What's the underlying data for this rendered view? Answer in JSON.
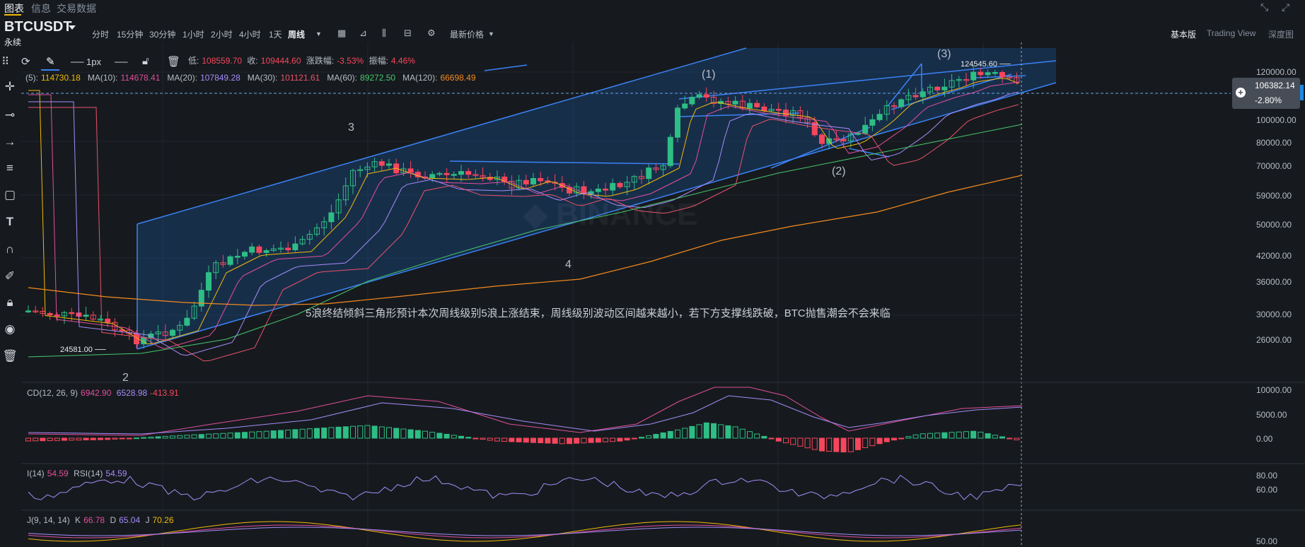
{
  "top_tabs": {
    "chart": "图表",
    "info": "信息",
    "trading_data": "交易数据"
  },
  "symbol": {
    "name": "BTCUSDT",
    "type": "永续"
  },
  "intervals": [
    "分时",
    "15分钟",
    "30分钟",
    "1小时",
    "2小时",
    "4小时",
    "1天",
    "周线"
  ],
  "price_type": "最新价格",
  "views": {
    "basic": "基本版",
    "tradingview": "Trading View",
    "depth": "深度图"
  },
  "drawbar": {
    "width_label": "1px"
  },
  "ohlc": {
    "low_label": "低:",
    "low": "108559.70",
    "close_label": "收:",
    "close": "109444.60",
    "change_label": "涨跌幅:",
    "change": "-3.53%",
    "amp_label": "振幅:",
    "amp": "4.46%"
  },
  "ma": [
    {
      "label": "(5):",
      "value": "114730.18",
      "color": "#f0b90b"
    },
    {
      "label": "MA(10):",
      "value": "114678.41",
      "color": "#e04f9c"
    },
    {
      "label": "MA(20):",
      "value": "107849.28",
      "color": "#a78bfa"
    },
    {
      "label": "MA(30):",
      "value": "101121.61",
      "color": "#e8526b"
    },
    {
      "label": "MA(60):",
      "value": "89272.50",
      "color": "#48c76f"
    },
    {
      "label": "MA(120):",
      "value": "66698.49",
      "color": "#f58a1f"
    }
  ],
  "price_axis": [
    "120000.00",
    "100000.00",
    "80000.00",
    "70000.00",
    "59000.00",
    "50000.00",
    "42000.00",
    "36000.00",
    "30000.00",
    "26000.00"
  ],
  "price_tag": {
    "price": "106382.14",
    "change": "-2.80%"
  },
  "annotations": {
    "wave1": "(1)",
    "wave2": "(2)",
    "wave3": "(3)",
    "num3": "3",
    "num4": "4",
    "num2": "2",
    "high": "124545.60",
    "low": "24581.00",
    "note": "5浪终结倾斜三角形预计本次周线级别5浪上涨结束，周线级别波动区间越来越小，若下方支撑线跌破，BTC抛售潮会不会来临"
  },
  "macd": {
    "label": "CD(12, 26, 9)",
    "dif": "6942.90",
    "dea": "6528.98",
    "hist": "-413.91",
    "axis": [
      "10000.00",
      "5000.00",
      "0.00"
    ]
  },
  "rsi": {
    "label1": "I(14)",
    "v1": "54.59",
    "label2": "RSI(14)",
    "v2": "54.59",
    "axis": [
      "80.00",
      "60.00"
    ]
  },
  "kdj": {
    "label": "J(9, 14, 14)",
    "k_label": "K",
    "k": "66.78",
    "d_label": "D",
    "d": "65.04",
    "j_label": "J",
    "j": "70.26",
    "axis": [
      "50.00"
    ]
  },
  "colors": {
    "up": "#2ebd85",
    "down": "#f6465d",
    "channel": "#3b82f6"
  }
}
